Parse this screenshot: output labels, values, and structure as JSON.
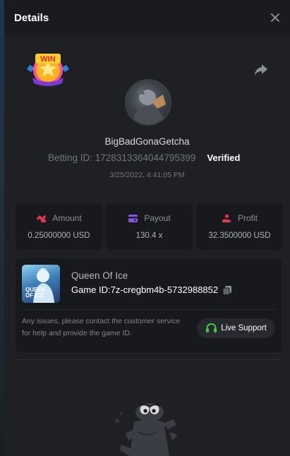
{
  "modal": {
    "title": "Details"
  },
  "badge": {
    "text": "WIN"
  },
  "player": {
    "username": "BigBadGonaGetcha",
    "betting_id": "Betting ID: 1728313364044795399",
    "verified_label": "Verified",
    "timestamp": "3/25/2022, 4:41:05 PM"
  },
  "stats": [
    {
      "label": "Amount",
      "value": "0.25000000 USD",
      "icon": "amount-icon",
      "color": "#e2354f"
    },
    {
      "label": "Payout",
      "value": "130.4 x",
      "icon": "wallet-icon",
      "color": "#8a54e6"
    },
    {
      "label": "Profit",
      "value": "32.3500000 USD",
      "icon": "profit-icon",
      "color": "#e2354f"
    }
  ],
  "game": {
    "thumb_text": "QUEEN OF ICE",
    "name": "Queen Of Ice",
    "game_id": "Game ID:7z-cregbm4b-5732988852"
  },
  "help": {
    "text": "Any issues, please contact the customer service for help and provide the game ID.",
    "support_label": "Live Support"
  },
  "colors": {
    "accent_green": "#49c34a",
    "modal_bg": "#1e2024",
    "card_bg": "#17191c"
  }
}
